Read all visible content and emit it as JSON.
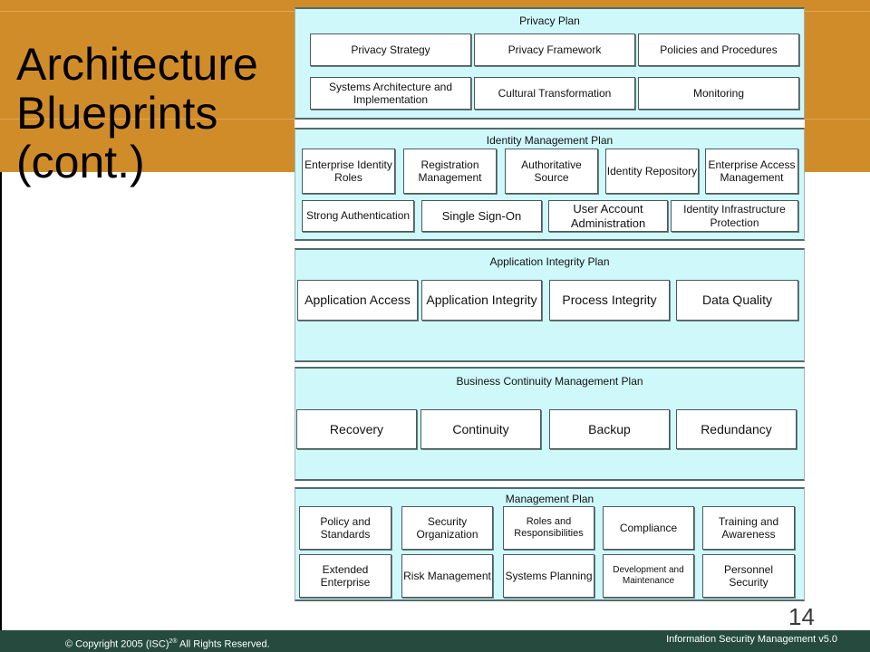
{
  "slide": {
    "title_lines": [
      "Architecture",
      "Blueprints",
      "(cont.)"
    ],
    "page_number": "14",
    "footer": {
      "copyright_prefix": "© Copyright 2005 (ISC)",
      "copyright_sup": "2®",
      "copyright_suffix": " All Rights Reserved.",
      "course": "Information Security Management v5.0"
    },
    "colors": {
      "band": "#d18c2a",
      "plan_fill": "#cff8fb",
      "footer": "#264b3e"
    }
  },
  "plans": [
    {
      "title": "Privacy Plan",
      "items": [
        "Privacy Strategy",
        "Privacy Framework",
        "Policies and Procedures",
        "Systems Architecture and Implementation",
        "Cultural Transformation",
        "Monitoring"
      ]
    },
    {
      "title": "Identity Management Plan",
      "items": [
        "Enterprise Identity Roles",
        "Registration Management",
        "Authoritative Source",
        "Identity Repository",
        "Enterprise Access Management",
        "Strong Authentication",
        "Single Sign-On",
        "User Account Administration",
        "Identity Infrastructure Protection"
      ]
    },
    {
      "title": "Application Integrity Plan",
      "items": [
        "Application Access",
        "Application Integrity",
        "Process Integrity",
        "Data Quality"
      ]
    },
    {
      "title": "Business Continuity Management Plan",
      "items": [
        "Recovery",
        "Continuity",
        "Backup",
        "Redundancy"
      ]
    },
    {
      "title": "Management Plan",
      "items": [
        "Policy and Standards",
        "Security Organization",
        "Roles and Responsibilities",
        "Compliance",
        "Training and Awareness",
        "Extended Enterprise",
        "Risk Management",
        "Systems Planning",
        "Development and Maintenance",
        "Personnel Security"
      ]
    }
  ]
}
